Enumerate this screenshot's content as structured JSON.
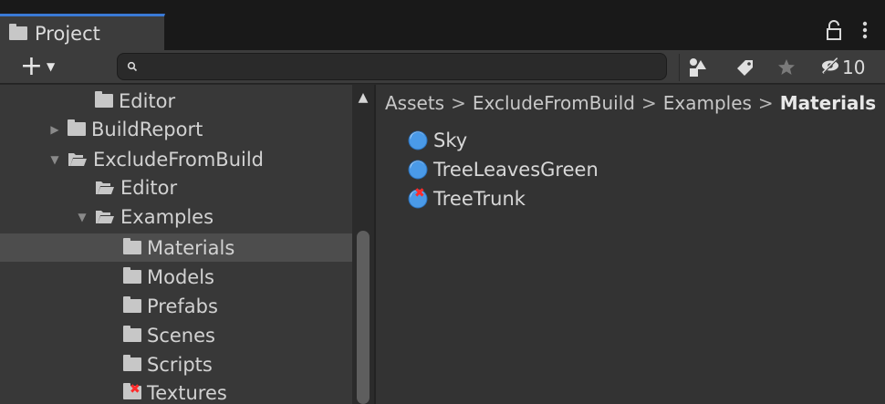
{
  "tab": {
    "title": "Project",
    "icon": "folder-icon"
  },
  "toolbar": {
    "create_label": "+",
    "search_placeholder": "",
    "hidden_count": "10",
    "buttons": [
      "filter-by-type-icon",
      "filter-by-label-icon",
      "favorite-star-icon",
      "hidden-packages-icon"
    ]
  },
  "tree": {
    "items": [
      {
        "label": "Editor",
        "arrow": "",
        "folder": "closed"
      },
      {
        "label": "BuildReport",
        "arrow": "▶",
        "folder": "closed"
      },
      {
        "label": "ExcludeFromBuild",
        "arrow": "▼",
        "folder": "open"
      },
      {
        "label": "Editor",
        "arrow": "",
        "folder": "open"
      },
      {
        "label": "Examples",
        "arrow": "▼",
        "folder": "open"
      },
      {
        "label": "Materials",
        "arrow": "",
        "folder": "closed",
        "selected": true
      },
      {
        "label": "Models",
        "arrow": "",
        "folder": "closed"
      },
      {
        "label": "Prefabs",
        "arrow": "",
        "folder": "closed"
      },
      {
        "label": "Scenes",
        "arrow": "",
        "folder": "closed"
      },
      {
        "label": "Scripts",
        "arrow": "",
        "folder": "closed"
      },
      {
        "label": "Textures",
        "arrow": "",
        "folder": "closed-broken"
      }
    ]
  },
  "breadcrumb": {
    "items": [
      "Assets",
      "ExcludeFromBuild",
      "Examples"
    ],
    "current": "Materials",
    "separator": ">"
  },
  "assets": [
    {
      "label": "Sky",
      "icon": "material-icon"
    },
    {
      "label": "TreeLeavesGreen",
      "icon": "material-icon"
    },
    {
      "label": "TreeTrunk",
      "icon": "material-missing-icon"
    }
  ],
  "colors": {
    "tab_accent": "#3a7ad6",
    "material_blue": "#4a9ae8",
    "error_red": "#ff2b2b",
    "selection": "#4d4d4d"
  }
}
